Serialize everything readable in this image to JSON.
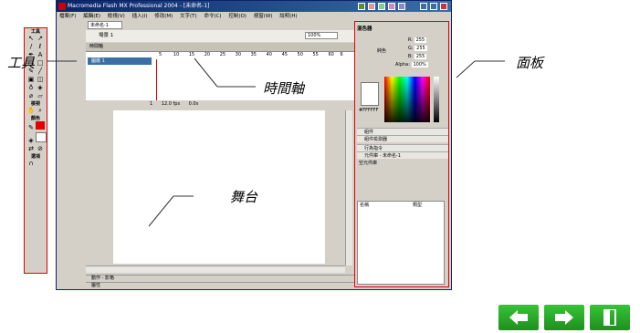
{
  "window": {
    "title": "Macromedia Flash MX Professional 2004 - [未命名-1]",
    "menu": [
      "檔案(F)",
      "編輯(E)",
      "檢視(V)",
      "插入(I)",
      "修改(M)",
      "文字(T)",
      "命令(C)",
      "控制(O)",
      "視窗(W)",
      "說明(H)"
    ]
  },
  "tools": {
    "title": "工具",
    "view_label": "檢視",
    "colors_label": "顏色",
    "options_label": "選項"
  },
  "document": {
    "tab": "未命名-1",
    "scene": "場景 1",
    "zoom": "100%"
  },
  "timeline": {
    "header": "時間軸",
    "layer_name": "圖層 1",
    "frame_numbers": [
      "5",
      "10",
      "15",
      "20",
      "25",
      "30",
      "35",
      "40",
      "45",
      "50",
      "55",
      "60",
      "6"
    ],
    "current_frame": "1",
    "fps": "12.0 fps",
    "elapsed": "0.0s"
  },
  "properties": {
    "actions": "動作 - 影格",
    "props": "屬性"
  },
  "panel": {
    "mixer_title": "混色器",
    "fill_type": "純色",
    "r_label": "R:",
    "r_value": "255",
    "g_label": "G:",
    "g_value": "255",
    "b_label": "B:",
    "b_value": "255",
    "alpha_label": "Alpha:",
    "alpha_value": "100%",
    "hex_value": "#FFFFFF",
    "rows": [
      "組件",
      "組件檢測器",
      "行為指令"
    ],
    "library_title": "元件庫 - 未命名-1",
    "library_sub": "空元件庫",
    "col_name": "名稱",
    "col_kind": "類型"
  },
  "callouts": {
    "tools": "工具",
    "panel": "面板",
    "timeline": "時間軸",
    "stage": "舞台"
  },
  "colors": {
    "accent": "#e40000",
    "title_bar": "#0a246a",
    "nav_green": "#2ca82c"
  },
  "nav": {
    "prev_icon": "arrow-left-icon",
    "next_icon": "arrow-right-icon",
    "exit_icon": "exit-door-icon"
  }
}
